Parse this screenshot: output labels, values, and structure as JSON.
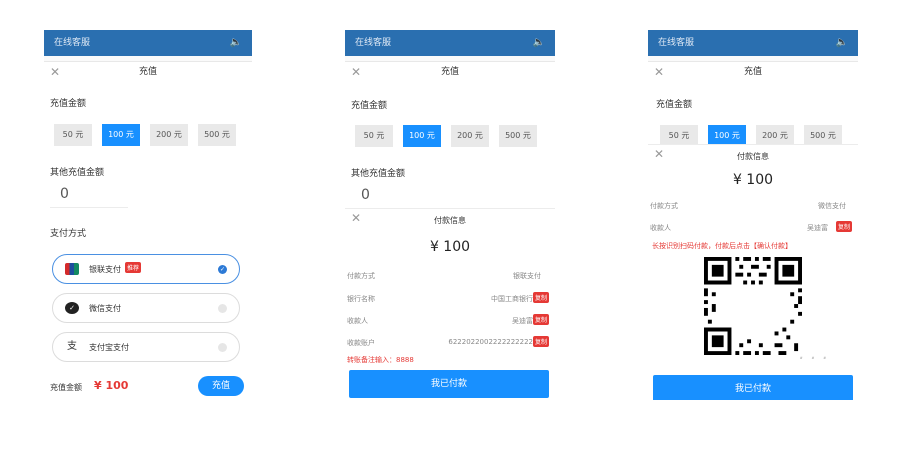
{
  "panel1": {
    "topbar_title": "在线客服",
    "header_title": "充值",
    "amount_label": "充值金额",
    "amounts": [
      "50 元",
      "100 元",
      "200 元",
      "500 元"
    ],
    "other_label": "其他充值金额",
    "other_value": "0",
    "method_label": "支付方式",
    "methods": [
      {
        "name": "银联支付",
        "badge": "推荐",
        "icon": "unionpay-icon"
      },
      {
        "name": "微信支付",
        "icon": "wechat-icon"
      },
      {
        "name": "支付宝支付",
        "icon": "alipay-icon",
        "glyph": "支"
      }
    ],
    "total_label": "充值金额",
    "total_value": "¥ 100",
    "submit_label": "充值"
  },
  "panel2": {
    "topbar_title": "在线客服",
    "header_title": "充值",
    "amount_label": "充值金额",
    "amounts": [
      "50 元",
      "100 元",
      "200 元",
      "500 元"
    ],
    "other_label": "其他充值金额",
    "other_value": "0",
    "modal": {
      "title": "付款信息",
      "amount": "¥ 100",
      "rows": [
        {
          "key": "付款方式",
          "value": "银联支付"
        },
        {
          "key": "银行名称",
          "value": "中国工商银行",
          "copy": "复制"
        },
        {
          "key": "收款人",
          "value": "吴迪富",
          "copy": "复制"
        },
        {
          "key": "收款账户",
          "value": "6222022002222222222",
          "copy": "复制"
        }
      ],
      "note": "转账备注输入：8888",
      "confirm_label": "我已付款"
    }
  },
  "panel3": {
    "topbar_title": "在线客服",
    "header_title": "充值",
    "amount_label": "充值金额",
    "amounts": [
      "50 元",
      "100 元",
      "200 元",
      "500 元"
    ],
    "modal": {
      "title": "付款信息",
      "amount": "¥ 100",
      "rows": [
        {
          "key": "付款方式",
          "value": "微信支付"
        },
        {
          "key": "收款人",
          "value": "吴迪富",
          "copy": "复制"
        }
      ],
      "note": "长按识别扫码付款，付款后点击【确认付款】",
      "confirm_label": "我已付款"
    }
  },
  "colors": {
    "primary": "#1890ff",
    "topbar": "#2a6fb0",
    "accent_red": "#e53935"
  }
}
